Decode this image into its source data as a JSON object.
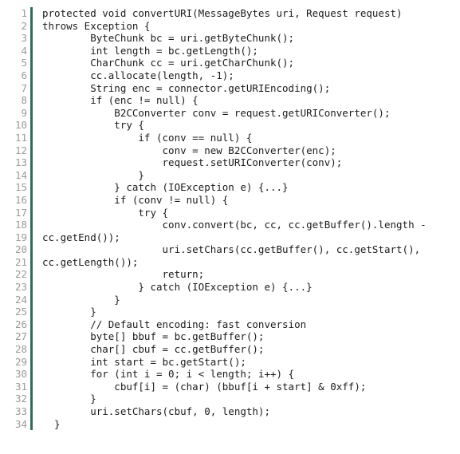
{
  "viewer": {
    "name": "code-snippet-viewer",
    "language": "java",
    "background_color": "#ffffff",
    "text_color": "#1b1b1b",
    "gutter_text_color": "#9a9a9a",
    "gutter_rule_color": "#2f6b5c",
    "first_line_number": 1,
    "last_line_number": 34,
    "total_lines": 34
  },
  "lines": [
    {
      "number": "1",
      "text": "protected void convertURI(MessageBytes uri, Request request)"
    },
    {
      "number": "2",
      "text": "throws Exception {"
    },
    {
      "number": "3",
      "text": "        ByteChunk bc = uri.getByteChunk();"
    },
    {
      "number": "4",
      "text": "        int length = bc.getLength();"
    },
    {
      "number": "5",
      "text": "        CharChunk cc = uri.getCharChunk();"
    },
    {
      "number": "6",
      "text": "        cc.allocate(length, -1);"
    },
    {
      "number": "7",
      "text": "        String enc = connector.getURIEncoding();"
    },
    {
      "number": "8",
      "text": "        if (enc != null) {"
    },
    {
      "number": "9",
      "text": "            B2CConverter conv = request.getURIConverter();"
    },
    {
      "number": "10",
      "text": "            try {"
    },
    {
      "number": "11",
      "text": "                if (conv == null) {"
    },
    {
      "number": "12",
      "text": "                    conv = new B2CConverter(enc);"
    },
    {
      "number": "13",
      "text": "                    request.setURIConverter(conv);"
    },
    {
      "number": "14",
      "text": "                }"
    },
    {
      "number": "15",
      "text": "            } catch (IOException e) {...}"
    },
    {
      "number": "16",
      "text": "            if (conv != null) {"
    },
    {
      "number": "17",
      "text": "                try {"
    },
    {
      "number": "18",
      "text": "                    conv.convert(bc, cc, cc.getBuffer().length -"
    },
    {
      "number": "19",
      "text": "cc.getEnd());"
    },
    {
      "number": "20",
      "text": "                    uri.setChars(cc.getBuffer(), cc.getStart(),"
    },
    {
      "number": "21",
      "text": "cc.getLength());"
    },
    {
      "number": "22",
      "text": "                    return;"
    },
    {
      "number": "23",
      "text": "                } catch (IOException e) {...}"
    },
    {
      "number": "24",
      "text": "            }"
    },
    {
      "number": "25",
      "text": "        }"
    },
    {
      "number": "26",
      "text": "        // Default encoding: fast conversion"
    },
    {
      "number": "27",
      "text": "        byte[] bbuf = bc.getBuffer();"
    },
    {
      "number": "28",
      "text": "        char[] cbuf = cc.getBuffer();"
    },
    {
      "number": "29",
      "text": "        int start = bc.getStart();"
    },
    {
      "number": "30",
      "text": "        for (int i = 0; i < length; i++) {"
    },
    {
      "number": "31",
      "text": "            cbuf[i] = (char) (bbuf[i + start] & 0xff);"
    },
    {
      "number": "32",
      "text": "        }"
    },
    {
      "number": "33",
      "text": "        uri.setChars(cbuf, 0, length);"
    },
    {
      "number": "34",
      "text": "  }"
    }
  ]
}
